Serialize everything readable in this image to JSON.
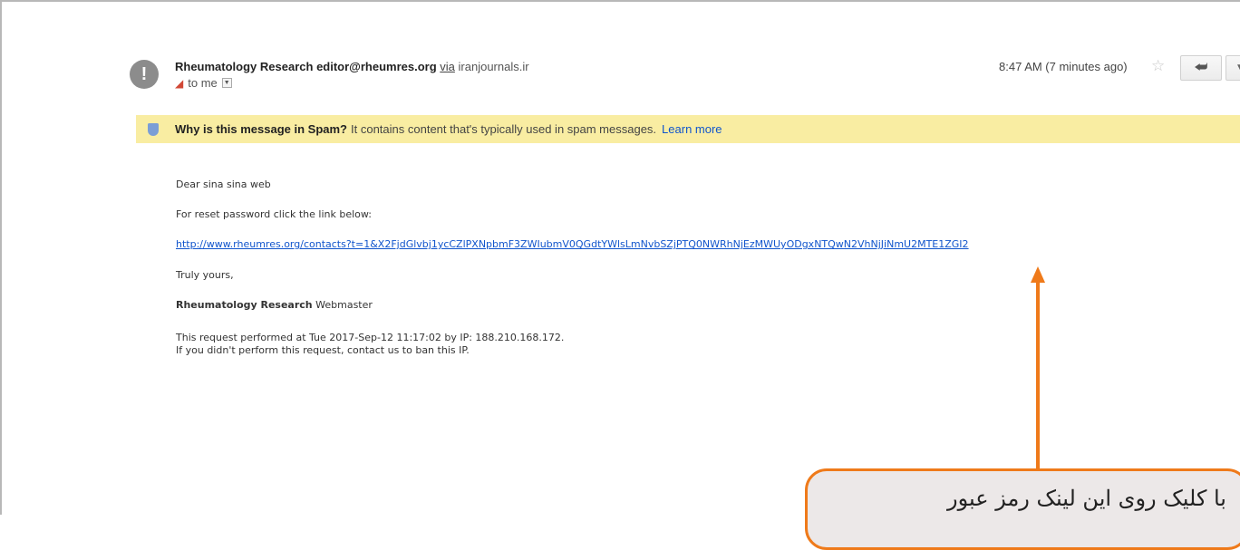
{
  "email": {
    "sender_name": "Rheumatology Research",
    "sender_email": "editor@rheumres.org",
    "via_label": "via",
    "via_domain": "iranjournals.ir",
    "recipient": "to me",
    "time": "8:47 AM (7 minutes ago)",
    "avatar_text": "!"
  },
  "spam_banner": {
    "question": "Why is this message in Spam?",
    "reason": "It contains content that's typically used in spam messages.",
    "learn_more": "Learn more"
  },
  "body": {
    "greeting": "Dear sina sina web",
    "instruction": "For reset password click the link below:",
    "reset_link": "http://www.rheumres.org/contacts?t=1&X2FjdGlvbj1ycCZlPXNpbmF3ZWIubmV0QGdtYWlsLmNvbSZjPTQ0NWRhNjEzMWUyODgxNTQwN2VhNjJiNmU2MTE1ZGI2",
    "closing": "Truly yours,",
    "signature_bold": "Rheumatology Research",
    "signature_rest": "Webmaster",
    "request_info": "This request performed at Tue 2017-Sep-12 11:17:02 by IP: 188.210.168.172.",
    "ban_info": "If you didn't perform this request, contact us to ban this IP."
  },
  "annotation": {
    "text": "با کلیک روی این لینک رمز عبور",
    "color": "#ef7a1a"
  },
  "colors": {
    "banner_bg": "#f9eda2",
    "link": "#1155cc"
  }
}
